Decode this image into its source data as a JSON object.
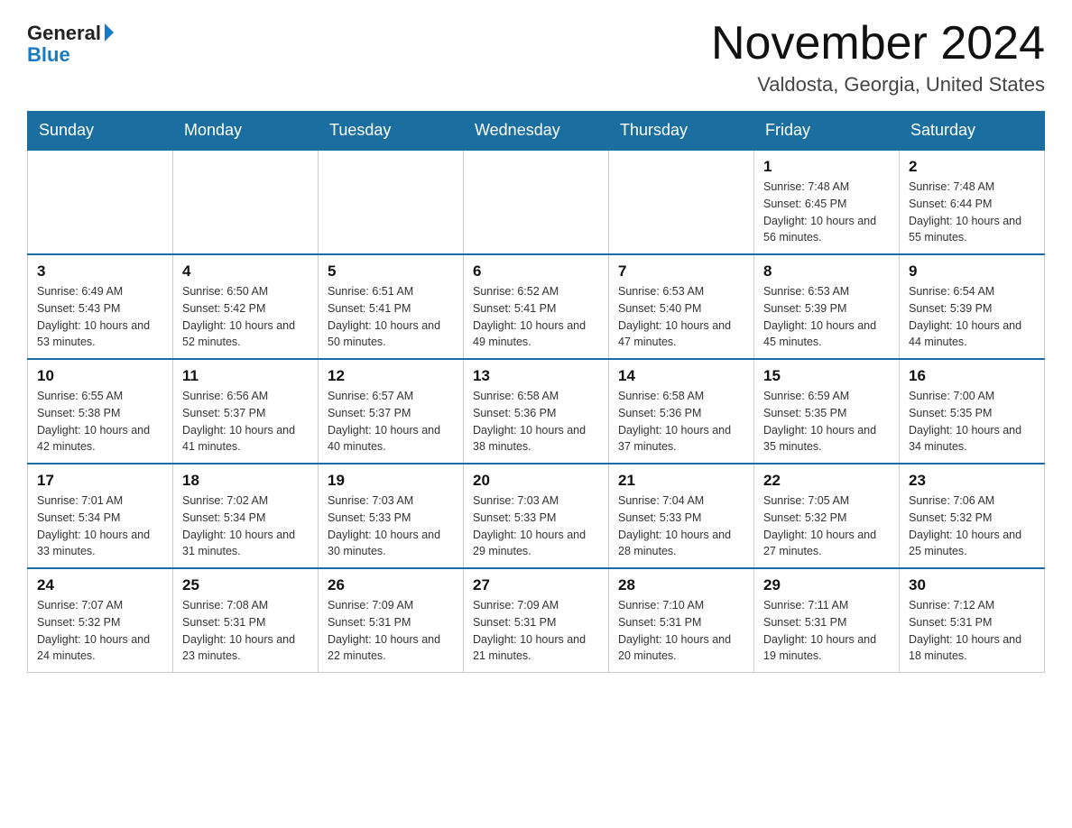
{
  "header": {
    "logo_general": "General",
    "logo_blue": "Blue",
    "month_year": "November 2024",
    "location": "Valdosta, Georgia, United States"
  },
  "days_of_week": [
    "Sunday",
    "Monday",
    "Tuesday",
    "Wednesday",
    "Thursday",
    "Friday",
    "Saturday"
  ],
  "weeks": [
    [
      {
        "day": "",
        "info": ""
      },
      {
        "day": "",
        "info": ""
      },
      {
        "day": "",
        "info": ""
      },
      {
        "day": "",
        "info": ""
      },
      {
        "day": "",
        "info": ""
      },
      {
        "day": "1",
        "info": "Sunrise: 7:48 AM\nSunset: 6:45 PM\nDaylight: 10 hours and 56 minutes."
      },
      {
        "day": "2",
        "info": "Sunrise: 7:48 AM\nSunset: 6:44 PM\nDaylight: 10 hours and 55 minutes."
      }
    ],
    [
      {
        "day": "3",
        "info": "Sunrise: 6:49 AM\nSunset: 5:43 PM\nDaylight: 10 hours and 53 minutes."
      },
      {
        "day": "4",
        "info": "Sunrise: 6:50 AM\nSunset: 5:42 PM\nDaylight: 10 hours and 52 minutes."
      },
      {
        "day": "5",
        "info": "Sunrise: 6:51 AM\nSunset: 5:41 PM\nDaylight: 10 hours and 50 minutes."
      },
      {
        "day": "6",
        "info": "Sunrise: 6:52 AM\nSunset: 5:41 PM\nDaylight: 10 hours and 49 minutes."
      },
      {
        "day": "7",
        "info": "Sunrise: 6:53 AM\nSunset: 5:40 PM\nDaylight: 10 hours and 47 minutes."
      },
      {
        "day": "8",
        "info": "Sunrise: 6:53 AM\nSunset: 5:39 PM\nDaylight: 10 hours and 45 minutes."
      },
      {
        "day": "9",
        "info": "Sunrise: 6:54 AM\nSunset: 5:39 PM\nDaylight: 10 hours and 44 minutes."
      }
    ],
    [
      {
        "day": "10",
        "info": "Sunrise: 6:55 AM\nSunset: 5:38 PM\nDaylight: 10 hours and 42 minutes."
      },
      {
        "day": "11",
        "info": "Sunrise: 6:56 AM\nSunset: 5:37 PM\nDaylight: 10 hours and 41 minutes."
      },
      {
        "day": "12",
        "info": "Sunrise: 6:57 AM\nSunset: 5:37 PM\nDaylight: 10 hours and 40 minutes."
      },
      {
        "day": "13",
        "info": "Sunrise: 6:58 AM\nSunset: 5:36 PM\nDaylight: 10 hours and 38 minutes."
      },
      {
        "day": "14",
        "info": "Sunrise: 6:58 AM\nSunset: 5:36 PM\nDaylight: 10 hours and 37 minutes."
      },
      {
        "day": "15",
        "info": "Sunrise: 6:59 AM\nSunset: 5:35 PM\nDaylight: 10 hours and 35 minutes."
      },
      {
        "day": "16",
        "info": "Sunrise: 7:00 AM\nSunset: 5:35 PM\nDaylight: 10 hours and 34 minutes."
      }
    ],
    [
      {
        "day": "17",
        "info": "Sunrise: 7:01 AM\nSunset: 5:34 PM\nDaylight: 10 hours and 33 minutes."
      },
      {
        "day": "18",
        "info": "Sunrise: 7:02 AM\nSunset: 5:34 PM\nDaylight: 10 hours and 31 minutes."
      },
      {
        "day": "19",
        "info": "Sunrise: 7:03 AM\nSunset: 5:33 PM\nDaylight: 10 hours and 30 minutes."
      },
      {
        "day": "20",
        "info": "Sunrise: 7:03 AM\nSunset: 5:33 PM\nDaylight: 10 hours and 29 minutes."
      },
      {
        "day": "21",
        "info": "Sunrise: 7:04 AM\nSunset: 5:33 PM\nDaylight: 10 hours and 28 minutes."
      },
      {
        "day": "22",
        "info": "Sunrise: 7:05 AM\nSunset: 5:32 PM\nDaylight: 10 hours and 27 minutes."
      },
      {
        "day": "23",
        "info": "Sunrise: 7:06 AM\nSunset: 5:32 PM\nDaylight: 10 hours and 25 minutes."
      }
    ],
    [
      {
        "day": "24",
        "info": "Sunrise: 7:07 AM\nSunset: 5:32 PM\nDaylight: 10 hours and 24 minutes."
      },
      {
        "day": "25",
        "info": "Sunrise: 7:08 AM\nSunset: 5:31 PM\nDaylight: 10 hours and 23 minutes."
      },
      {
        "day": "26",
        "info": "Sunrise: 7:09 AM\nSunset: 5:31 PM\nDaylight: 10 hours and 22 minutes."
      },
      {
        "day": "27",
        "info": "Sunrise: 7:09 AM\nSunset: 5:31 PM\nDaylight: 10 hours and 21 minutes."
      },
      {
        "day": "28",
        "info": "Sunrise: 7:10 AM\nSunset: 5:31 PM\nDaylight: 10 hours and 20 minutes."
      },
      {
        "day": "29",
        "info": "Sunrise: 7:11 AM\nSunset: 5:31 PM\nDaylight: 10 hours and 19 minutes."
      },
      {
        "day": "30",
        "info": "Sunrise: 7:12 AM\nSunset: 5:31 PM\nDaylight: 10 hours and 18 minutes."
      }
    ]
  ]
}
